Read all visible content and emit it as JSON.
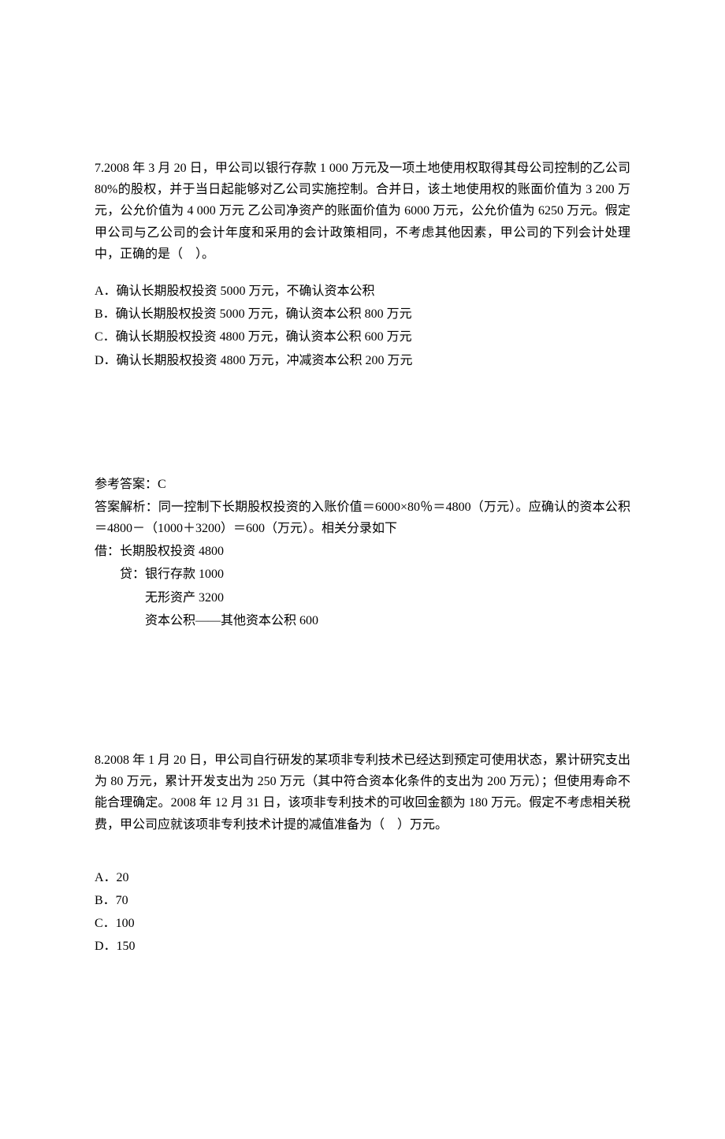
{
  "q7": {
    "text": "7.2008 年 3 月 20 日，甲公司以银行存款 1 000 万元及一项土地使用权取得其母公司控制的乙公司 80%的股权，并于当日起能够对乙公司实施控制。合并日，该土地使用权的账面价值为 3 200 万元，公允价值为 4 000 万元  乙公司净资产的账面价值为 6000 万元，公允价值为 6250 万元。假定甲公司与乙公司的会计年度和采用的会计政策相同，不考虑其他因素，甲公司的下列会计处理中，正确的是（　）。",
    "optA": "A．确认长期股权投资 5000 万元，不确认资本公积",
    "optB": "B．确认长期股权投资 5000 万元，确认资本公积 800 万元",
    "optC": "C．确认长期股权投资 4800 万元，确认资本公积 600 万元",
    "optD": "D．确认长期股权投资 4800 万元，冲减资本公积 200 万元",
    "ansLabel": "参考答案：C",
    "explain": "答案解析：同一控制下长期股权投资的入账价值＝6000×80％＝4800（万元）。应确认的资本公积＝4800－（1000＋3200）＝600（万元）。相关分录如下",
    "j1": "借：长期股权投资 4800",
    "j2": "贷：银行存款 1000",
    "j3": "无形资产 3200",
    "j4": "资本公积——其他资本公积 600"
  },
  "q8": {
    "text": "8.2008 年 1 月 20 日，甲公司自行研发的某项非专利技术已经达到预定可使用状态，累计研究支出为 80 万元，累计开发支出为 250 万元（其中符合资本化条件的支出为 200 万元）；但使用寿命不能合理确定。2008 年 12 月 31 日，该项非专利技术的可收回金额为 180 万元。假定不考虑相关税费，甲公司应就该项非专利技术计提的减值准备为（　）万元。",
    "optA": "A．20",
    "optB": "B．70",
    "optC": "C．100",
    "optD": "D．150"
  }
}
